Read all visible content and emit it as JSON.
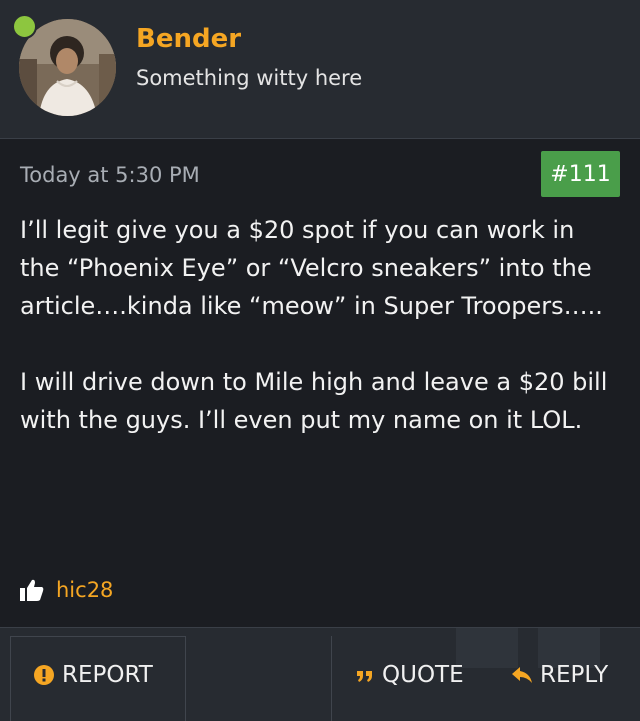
{
  "user": {
    "name": "Bender",
    "title": "Something witty here"
  },
  "post": {
    "timestamp": "Today at 5:30 PM",
    "number": "#111",
    "paragraphs": [
      "I’ll legit give you a $20 spot if you can work in the “Phoenix Eye” or “Velcro sneakers” into the article….kinda like “meow” in Super Troopers…..",
      "I will drive down to Mile high and leave a $20 bill with the guys. I’ll even put my name on it LOL."
    ],
    "liked_by": "hic28"
  },
  "actions": {
    "report": "REPORT",
    "quote": "QUOTE",
    "reply": "REPLY"
  },
  "colors": {
    "accent": "#f5a623",
    "post_number_bg": "#4a9e4a",
    "online": "#8dc63f"
  },
  "icons": [
    "online-status-icon",
    "thumbs-up-icon",
    "warning-icon",
    "quote-icon",
    "reply-icon"
  ]
}
